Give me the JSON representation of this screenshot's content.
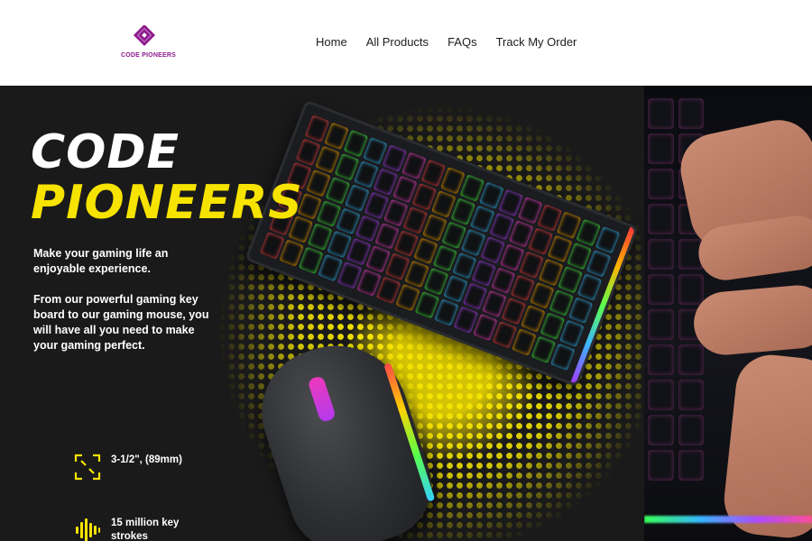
{
  "header": {
    "logo_text": "CODE PIONEERS",
    "nav": [
      {
        "label": "Home"
      },
      {
        "label": "All Products"
      },
      {
        "label": "FAQs"
      },
      {
        "label": "Track My Order"
      }
    ]
  },
  "hero": {
    "title_line_1": "CODE",
    "title_line_2": "PIONEERS",
    "intro_1": "Make your gaming life an enjoyable experience.",
    "intro_2": "From our powerful gaming key board to our gaming mouse, you will have all you need to make your gaming perfect.",
    "specs": [
      {
        "icon": "expand-icon",
        "label": "3-1/2\", (89mm)"
      },
      {
        "icon": "sound-wave-icon",
        "label": "15 million key strokes"
      }
    ]
  },
  "colors": {
    "brand_purple": "#8e1a8f",
    "hero_background": "#1a1a1a",
    "accent_yellow": "#f7e300"
  }
}
